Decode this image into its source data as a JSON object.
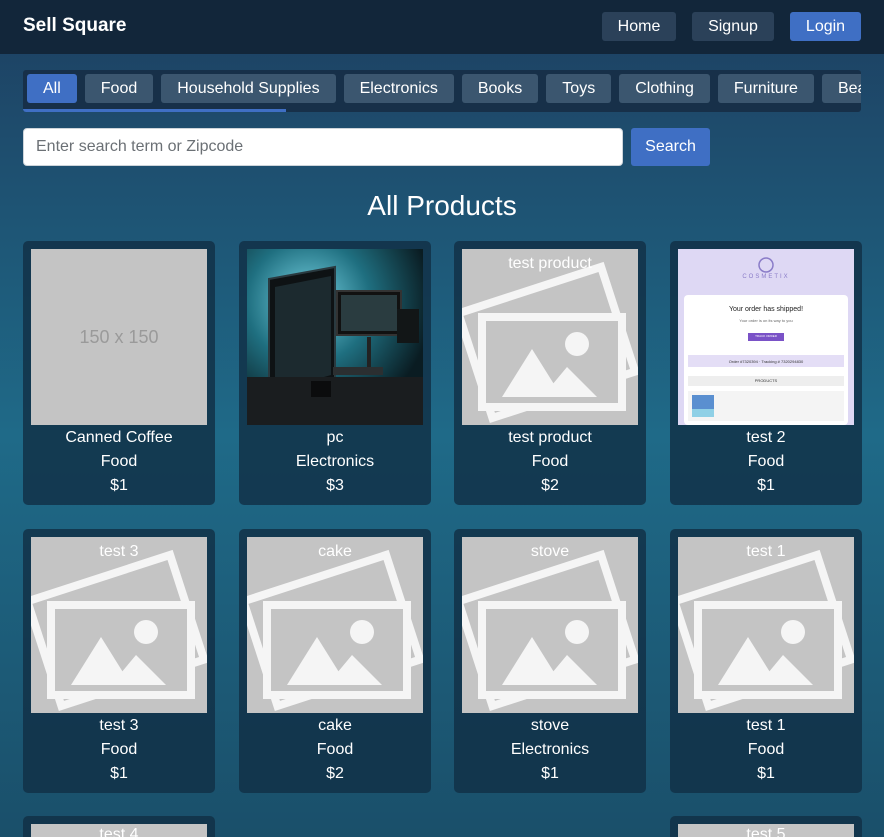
{
  "navbar": {
    "brand": "Sell Square",
    "links": [
      "Home",
      "Signup",
      "Login"
    ]
  },
  "categories": [
    "All",
    "Food",
    "Household Supplies",
    "Electronics",
    "Books",
    "Toys",
    "Clothing",
    "Furniture",
    "Beauty"
  ],
  "search": {
    "placeholder": "Enter search term or Zipcode",
    "button": "Search"
  },
  "main": {
    "title": "All Products"
  },
  "products": [
    {
      "name": "Canned Coffee",
      "category": "Food",
      "price": "$1",
      "image": "placeholder-150",
      "placeholder_text": "150 x 150"
    },
    {
      "name": "pc",
      "category": "Electronics",
      "price": "$3",
      "image": "desk-setup-photo"
    },
    {
      "name": "test product",
      "category": "Food",
      "price": "$2",
      "image": "broken-image",
      "alt": "test product"
    },
    {
      "name": "test 2",
      "category": "Food",
      "price": "$1",
      "image": "email-screenshot",
      "email": {
        "brand": "COSMETIX",
        "headline": "Your order has shipped!",
        "subline": "Your order is on its way to you",
        "button": "TRACK ORDER",
        "order_line": "Order #7320394 · Tracking # 7320294830",
        "section": "PRODUCTS"
      }
    },
    {
      "name": "test 3",
      "category": "Food",
      "price": "$1",
      "image": "broken-image",
      "alt": "test 3"
    },
    {
      "name": "cake",
      "category": "Food",
      "price": "$2",
      "image": "broken-image",
      "alt": "cake"
    },
    {
      "name": "stove",
      "category": "Electronics",
      "price": "$1",
      "image": "broken-image",
      "alt": "stove"
    },
    {
      "name": "test 1",
      "category": "Food",
      "price": "$1",
      "image": "broken-image",
      "alt": "test 1"
    },
    {
      "name": "test 4",
      "category": "",
      "price": "",
      "image": "broken-image",
      "alt": "test 4"
    },
    {
      "name": "test 5",
      "category": "",
      "price": "",
      "image": "broken-image",
      "alt": "test 5"
    }
  ],
  "colors": {
    "navbar": "#12263a",
    "accent": "#3f6fc4",
    "button": "#2b4159",
    "category": "#3b566f",
    "card": "#113046"
  }
}
